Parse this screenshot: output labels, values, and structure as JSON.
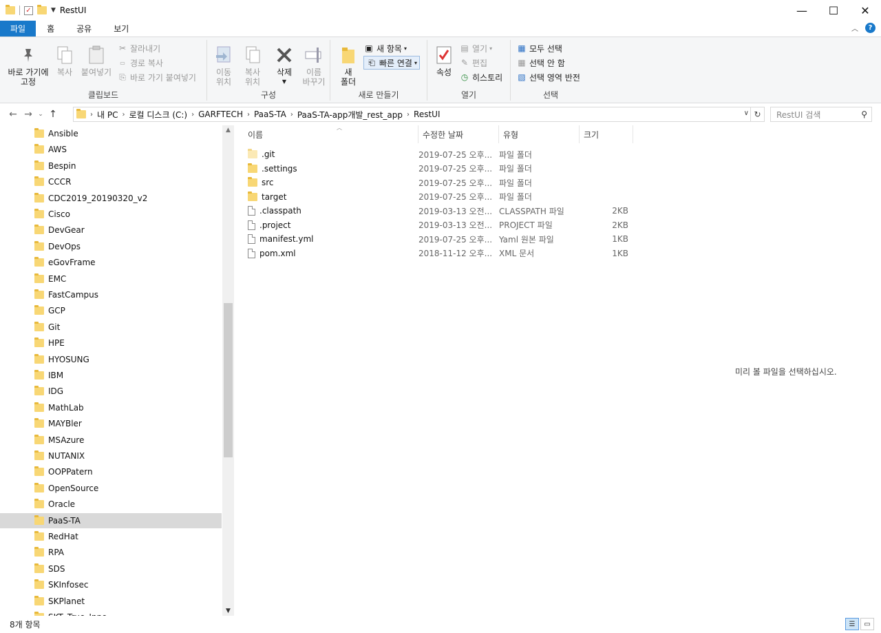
{
  "window": {
    "title": "RestUI"
  },
  "tabs": [
    "파일",
    "홈",
    "공유",
    "보기"
  ],
  "ribbon": {
    "clipboard": {
      "label": "클립보드",
      "pin": "바로 가기에\n고정",
      "copy": "복사",
      "paste": "붙여넣기",
      "cut": "잘라내기",
      "copy_path": "경로 복사",
      "paste_shortcut": "바로 가기 붙여넣기"
    },
    "organize": {
      "label": "구성",
      "move_to": "이동\n위치",
      "copy_to": "복사\n위치",
      "delete": "삭제",
      "rename": "이름\n바꾸기"
    },
    "new": {
      "label": "새로 만들기",
      "new_folder": "새\n폴더",
      "new_item": "새 항목",
      "easy_access": "빠른 연결"
    },
    "open": {
      "label": "열기",
      "properties": "속성",
      "open": "열기",
      "edit": "편집",
      "history": "히스토리"
    },
    "select": {
      "label": "선택",
      "select_all": "모두 선택",
      "select_none": "선택 안 함",
      "invert": "선택 영역 반전"
    }
  },
  "address": {
    "crumbs": [
      "내 PC",
      "로컬 디스크 (C:)",
      "GARFTECH",
      "PaaS-TA",
      "PaaS-TA-app개발_rest_app",
      "RestUI"
    ],
    "search_placeholder": "RestUI 검색"
  },
  "tree": [
    "Ansible",
    "AWS",
    "Bespin",
    "CCCR",
    "CDC2019_20190320_v2",
    "Cisco",
    "DevGear",
    "DevOps",
    "eGovFrame",
    "EMC",
    "FastCampus",
    "GCP",
    "Git",
    "HPE",
    "HYOSUNG",
    "IBM",
    "IDG",
    "MathLab",
    "MAYBler",
    "MSAzure",
    "NUTANIX",
    "OOPPatern",
    "OpenSource",
    "Oracle",
    "PaaS-TA",
    "RedHat",
    "RPA",
    "SDS",
    "SKInfosec",
    "SKPlanet",
    "SKT_True_Inno"
  ],
  "tree_selected": "PaaS-TA",
  "columns": {
    "name": "이름",
    "date": "수정한 날짜",
    "type": "유형",
    "size": "크기"
  },
  "files": [
    {
      "name": ".git",
      "date": "2019-07-25 오후...",
      "type": "파일 폴더",
      "size": "",
      "kind": "folder-light"
    },
    {
      "name": ".settings",
      "date": "2019-07-25 오후...",
      "type": "파일 폴더",
      "size": "",
      "kind": "folder"
    },
    {
      "name": "src",
      "date": "2019-07-25 오후...",
      "type": "파일 폴더",
      "size": "",
      "kind": "folder"
    },
    {
      "name": "target",
      "date": "2019-07-25 오후...",
      "type": "파일 폴더",
      "size": "",
      "kind": "folder"
    },
    {
      "name": ".classpath",
      "date": "2019-03-13 오전...",
      "type": "CLASSPATH 파일",
      "size": "2KB",
      "kind": "file"
    },
    {
      "name": ".project",
      "date": "2019-03-13 오전...",
      "type": "PROJECT 파일",
      "size": "2KB",
      "kind": "file"
    },
    {
      "name": "manifest.yml",
      "date": "2019-07-25 오후...",
      "type": "Yaml 원본 파일",
      "size": "1KB",
      "kind": "file"
    },
    {
      "name": "pom.xml",
      "date": "2018-11-12 오후...",
      "type": "XML 문서",
      "size": "1KB",
      "kind": "file"
    }
  ],
  "preview_message": "미리 볼 파일을 선택하십시오.",
  "status": {
    "count": "8개 항목"
  }
}
